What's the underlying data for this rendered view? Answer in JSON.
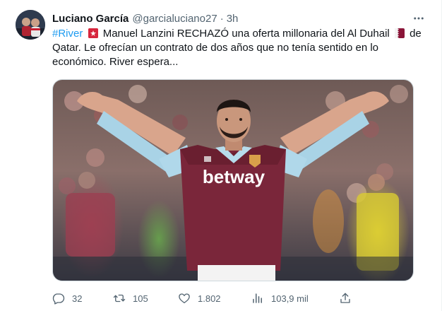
{
  "tweet": {
    "author_name": "Luciano García",
    "handle": "@garcialuciano27",
    "separator": "·",
    "time": "3h",
    "text": {
      "hashtag": "#River",
      "part1": " Manuel Lanzini RECHAZÓ una oferta millonaria del Al Duhail ",
      "part2": " de Qatar. Le ofrecían un contrato de dos años que no tenía sentido en lo económico. River espera..."
    },
    "icons": {
      "emoji1": "river-flag-icon",
      "emoji2": "qatar-flag-icon",
      "more": "more-icon"
    },
    "media": {
      "shirt_sponsor": "betway"
    },
    "actions": {
      "replies": "32",
      "retweets": "105",
      "likes": "1.802",
      "views": "103,9 mil"
    }
  },
  "colors": {
    "accent": "#1d9bf0",
    "secondary_text": "#536471",
    "emoji_red": "#d7263d",
    "qatar_maroon": "#8a1538"
  }
}
